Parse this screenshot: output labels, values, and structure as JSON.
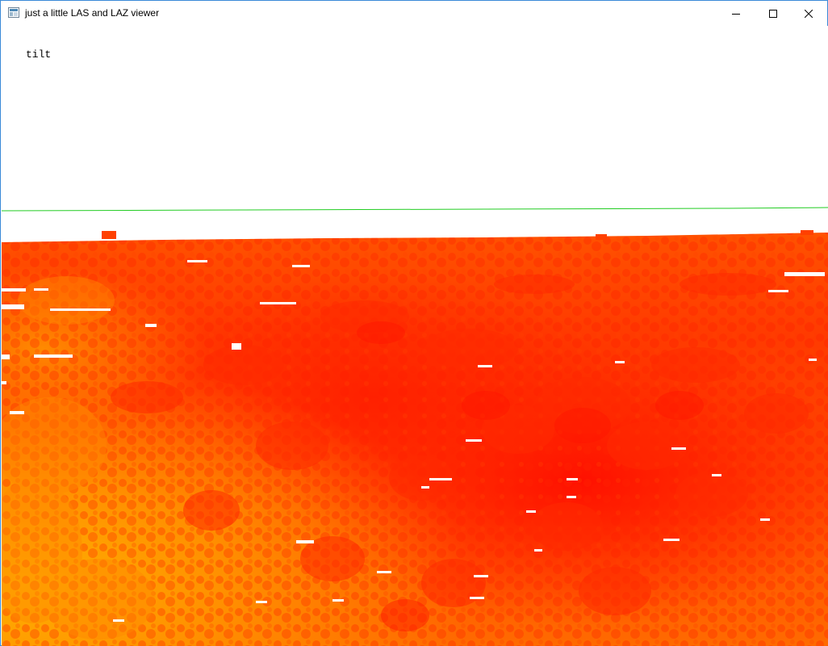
{
  "window": {
    "title": "just a little LAS and LAZ viewer",
    "controls": {
      "minimize_icon": "minimize-icon",
      "maximize_icon": "maximize-icon",
      "close_icon": "close-icon"
    }
  },
  "viewer": {
    "mode_label": "tilt",
    "colors": {
      "horizon_line": "#22cc22",
      "far_elevation": "#ff1100",
      "mid_elevation": "#ff5a00",
      "near_elevation": "#ffa400",
      "background": "#ffffff"
    }
  }
}
